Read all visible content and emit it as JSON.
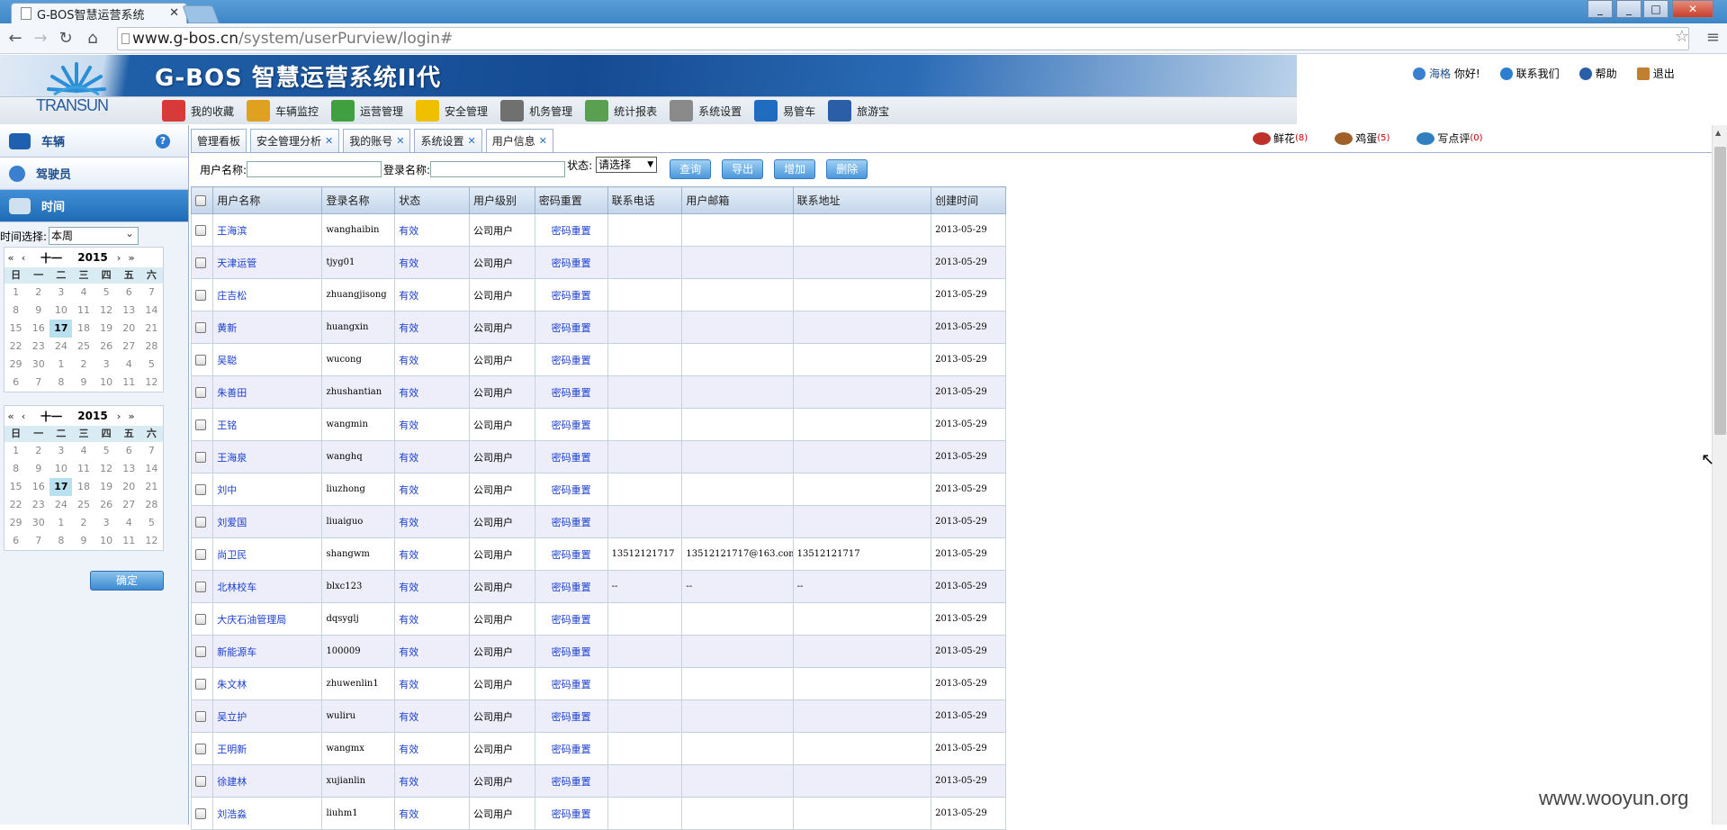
{
  "browser": {
    "tab_title": "G-BOS智慧运营系统",
    "url_domain": "www.g-bos.cn",
    "url_path": "/system/userPurview/login#",
    "window_buttons": [
      "_",
      "□",
      "✕"
    ]
  },
  "header": {
    "logo_text": "TRANSUN",
    "app_title": "G-BOS 智慧运营系统II代",
    "nav": [
      {
        "label": "我的收藏",
        "icon": "favorites-icon",
        "color": "#d83a3a"
      },
      {
        "label": "车辆监控",
        "icon": "vehicle-monitor-icon",
        "color": "#e0a020"
      },
      {
        "label": "运营管理",
        "icon": "operations-icon",
        "color": "#40a040"
      },
      {
        "label": "安全管理",
        "icon": "warning-icon",
        "color": "#f0c000"
      },
      {
        "label": "机务管理",
        "icon": "tools-icon",
        "color": "#707070"
      },
      {
        "label": "统计报表",
        "icon": "chart-icon",
        "color": "#5aa050"
      },
      {
        "label": "系统设置",
        "icon": "gear-icon",
        "color": "#8a8a8a"
      },
      {
        "label": "易管车",
        "icon": "yi-icon",
        "color": "#1f6cc0"
      },
      {
        "label": "旅游宝",
        "icon": "globe-icon",
        "color": "#2a5fa8"
      }
    ],
    "user": {
      "name": "海格",
      "greeting": "你好!"
    },
    "links": [
      {
        "label": "联系我们",
        "icon": "contact-icon",
        "color": "#2a7fd0"
      },
      {
        "label": "帮助",
        "icon": "help-icon",
        "color": "#2a5fa8"
      },
      {
        "label": "退出",
        "icon": "exit-icon",
        "color": "#c08030"
      }
    ]
  },
  "sidebar": {
    "sections": [
      {
        "label": "车辆",
        "icon": "car-icon"
      },
      {
        "label": "驾驶员",
        "icon": "driver-icon"
      },
      {
        "label": "时间",
        "icon": "calendar-icon"
      }
    ],
    "time_label": "时间选择:",
    "time_value": "本周",
    "calendars": [
      {
        "month": "十一",
        "year": "2015"
      },
      {
        "month": "十一",
        "year": "2015"
      }
    ],
    "weekdays": [
      "日",
      "一",
      "二",
      "三",
      "四",
      "五",
      "六"
    ],
    "days": [
      "1",
      "2",
      "3",
      "4",
      "5",
      "6",
      "7",
      "8",
      "9",
      "10",
      "11",
      "12",
      "13",
      "14",
      "15",
      "16",
      "17",
      "18",
      "19",
      "20",
      "21",
      "22",
      "23",
      "24",
      "25",
      "26",
      "27",
      "28",
      "29",
      "30",
      "1",
      "2",
      "3",
      "4",
      "5",
      "6",
      "7",
      "8",
      "9",
      "10",
      "11",
      "12"
    ],
    "today": "17",
    "confirm_label": "确定"
  },
  "content": {
    "tabs": [
      {
        "label": "管理看板",
        "closable": false
      },
      {
        "label": "安全管理分析",
        "closable": true
      },
      {
        "label": "我的账号",
        "closable": true
      },
      {
        "label": "系统设置",
        "closable": true
      },
      {
        "label": "用户信息",
        "closable": true
      }
    ],
    "promo": [
      {
        "label": "鲜花",
        "count": "(8)",
        "color": "#c0302a"
      },
      {
        "label": "鸡蛋",
        "count": "(5)",
        "color": "#a0602a"
      },
      {
        "label": "写点评",
        "count": "(0)",
        "color": "#3080c0"
      }
    ],
    "filter": {
      "username_label": "用户名称:",
      "login_label": "登录名称:",
      "status_label": "状态:",
      "status_value": "请选择",
      "buttons": [
        "查询",
        "导出",
        "增加",
        "删除"
      ]
    },
    "columns": [
      "用户名称",
      "登录名称",
      "状态",
      "用户级别",
      "密码重置",
      "联系电话",
      "用户邮箱",
      "联系地址",
      "创建时间"
    ],
    "rows": [
      {
        "name": "王海滨",
        "login": "wanghaibin",
        "status": "有效",
        "level": "公司用户",
        "reset": "密码重置",
        "phone": "",
        "email": "",
        "address": "",
        "created": "2013-05-29"
      },
      {
        "name": "天津运管",
        "login": "tjyg01",
        "status": "有效",
        "level": "公司用户",
        "reset": "密码重置",
        "phone": "",
        "email": "",
        "address": "",
        "created": "2013-05-29"
      },
      {
        "name": "庄吉松",
        "login": "zhuangjisong",
        "status": "有效",
        "level": "公司用户",
        "reset": "密码重置",
        "phone": "",
        "email": "",
        "address": "",
        "created": "2013-05-29"
      },
      {
        "name": "黄新",
        "login": "huangxin",
        "status": "有效",
        "level": "公司用户",
        "reset": "密码重置",
        "phone": "",
        "email": "",
        "address": "",
        "created": "2013-05-29"
      },
      {
        "name": "吴聪",
        "login": "wucong",
        "status": "有效",
        "level": "公司用户",
        "reset": "密码重置",
        "phone": "",
        "email": "",
        "address": "",
        "created": "2013-05-29"
      },
      {
        "name": "朱善田",
        "login": "zhushantian",
        "status": "有效",
        "level": "公司用户",
        "reset": "密码重置",
        "phone": "",
        "email": "",
        "address": "",
        "created": "2013-05-29"
      },
      {
        "name": "王铭",
        "login": "wangmin",
        "status": "有效",
        "level": "公司用户",
        "reset": "密码重置",
        "phone": "",
        "email": "",
        "address": "",
        "created": "2013-05-29"
      },
      {
        "name": "王海泉",
        "login": "wanghq",
        "status": "有效",
        "level": "公司用户",
        "reset": "密码重置",
        "phone": "",
        "email": "",
        "address": "",
        "created": "2013-05-29"
      },
      {
        "name": "刘中",
        "login": "liuzhong",
        "status": "有效",
        "level": "公司用户",
        "reset": "密码重置",
        "phone": "",
        "email": "",
        "address": "",
        "created": "2013-05-29"
      },
      {
        "name": "刘爱国",
        "login": "liuaiguo",
        "status": "有效",
        "level": "公司用户",
        "reset": "密码重置",
        "phone": "",
        "email": "",
        "address": "",
        "created": "2013-05-29"
      },
      {
        "name": "尚卫民",
        "login": "shangwm",
        "status": "有效",
        "level": "公司用户",
        "reset": "密码重置",
        "phone": "13512121717",
        "email": "13512121717@163.com",
        "address": "13512121717",
        "created": "2013-05-29"
      },
      {
        "name": "北林校车",
        "login": "blxc123",
        "status": "有效",
        "level": "公司用户",
        "reset": "密码重置",
        "phone": "--",
        "email": "--",
        "address": "--",
        "created": "2013-05-29"
      },
      {
        "name": "大庆石油管理局",
        "login": "dqsyglj",
        "status": "有效",
        "level": "公司用户",
        "reset": "密码重置",
        "phone": "",
        "email": "",
        "address": "",
        "created": "2013-05-29"
      },
      {
        "name": "新能源车",
        "login": "100009",
        "status": "有效",
        "level": "公司用户",
        "reset": "密码重置",
        "phone": "",
        "email": "",
        "address": "",
        "created": "2013-05-29"
      },
      {
        "name": "朱文林",
        "login": "zhuwenlin1",
        "status": "有效",
        "level": "公司用户",
        "reset": "密码重置",
        "phone": "",
        "email": "",
        "address": "",
        "created": "2013-05-29"
      },
      {
        "name": "吴立护",
        "login": "wuliru",
        "status": "有效",
        "level": "公司用户",
        "reset": "密码重置",
        "phone": "",
        "email": "",
        "address": "",
        "created": "2013-05-29"
      },
      {
        "name": "王明新",
        "login": "wangmx",
        "status": "有效",
        "level": "公司用户",
        "reset": "密码重置",
        "phone": "",
        "email": "",
        "address": "",
        "created": "2013-05-29"
      },
      {
        "name": "徐建林",
        "login": "xujianlin",
        "status": "有效",
        "level": "公司用户",
        "reset": "密码重置",
        "phone": "",
        "email": "",
        "address": "",
        "created": "2013-05-29"
      },
      {
        "name": "刘浩淼",
        "login": "liuhm1",
        "status": "有效",
        "level": "公司用户",
        "reset": "密码重置",
        "phone": "",
        "email": "",
        "address": "",
        "created": "2013-05-29"
      }
    ]
  },
  "watermark": "www.wooyun.org"
}
